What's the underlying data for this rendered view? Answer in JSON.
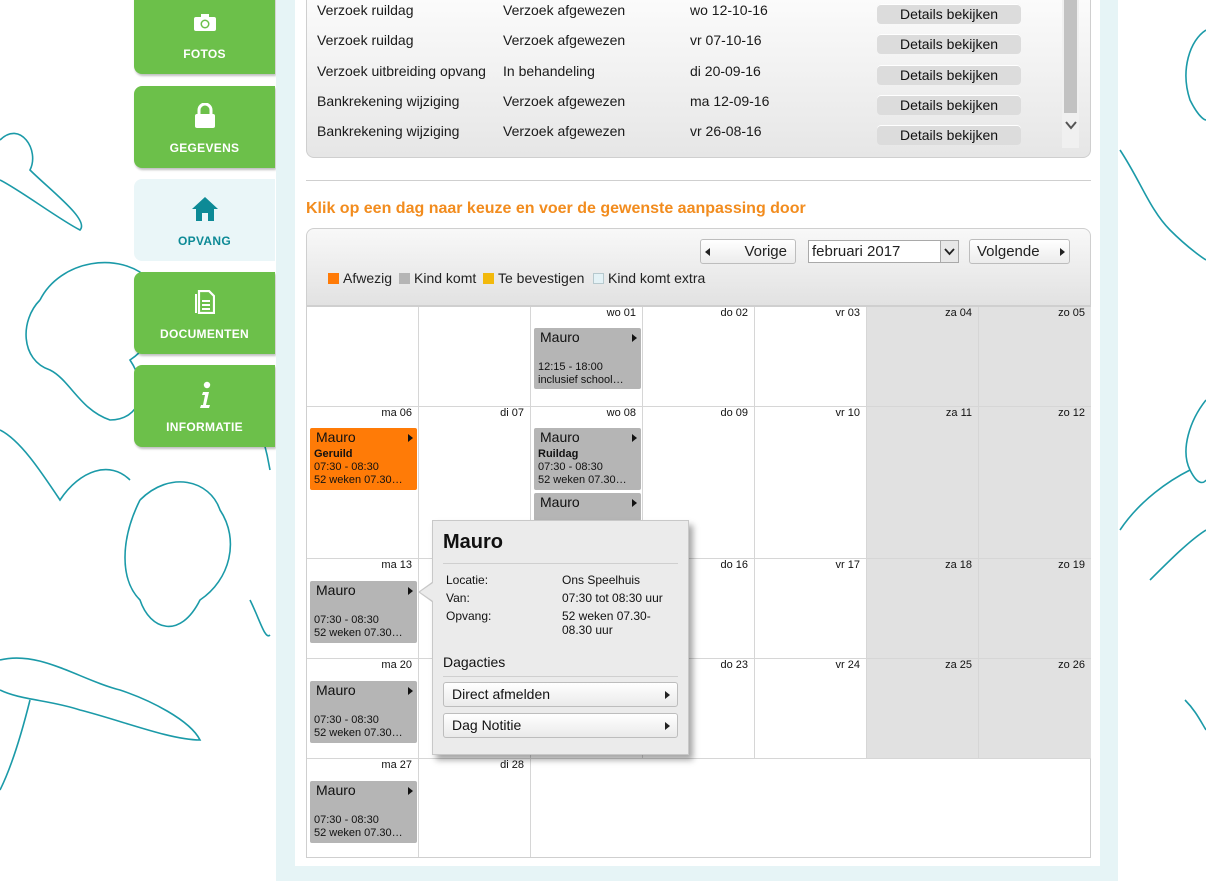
{
  "sidebar": {
    "items": [
      {
        "label": "FOTOS",
        "icon": "camera-icon"
      },
      {
        "label": "GEGEVENS",
        "icon": "lock-icon"
      },
      {
        "label": "OPVANG",
        "icon": "home-icon",
        "active": true
      },
      {
        "label": "DOCUMENTEN",
        "icon": "document-icon"
      },
      {
        "label": "INFORMATIE",
        "icon": "info-icon"
      }
    ]
  },
  "requests": {
    "rows": [
      {
        "type": "Verzoek ruildag",
        "status": "Verzoek afgewezen",
        "date": "wo 12-10-16",
        "button": "Details bekijken"
      },
      {
        "type": "Verzoek ruildag",
        "status": "Verzoek afgewezen",
        "date": "vr 07-10-16",
        "button": "Details bekijken"
      },
      {
        "type": "Verzoek uitbreiding opvang",
        "status": "In behandeling",
        "date": "di 20-09-16",
        "button": "Details bekijken"
      },
      {
        "type": "Bankrekening wijziging",
        "status": "Verzoek afgewezen",
        "date": "ma 12-09-16",
        "button": "Details bekijken"
      },
      {
        "type": "Bankrekening wijziging",
        "status": "Verzoek afgewezen",
        "date": "vr 26-08-16",
        "button": "Details bekijken"
      }
    ]
  },
  "calendar": {
    "instruction": "Klik op een dag naar keuze en voer de gewenste aanpassing door",
    "prev_label": "Vorige",
    "next_label": "Volgende",
    "month": "februari 2017",
    "legend": [
      {
        "label": "Afwezig",
        "color": "#ff7b07"
      },
      {
        "label": "Kind komt",
        "color": "#b5b5b5"
      },
      {
        "label": "Te bevestigen",
        "color": "#f2b90c"
      },
      {
        "label": "Kind komt extra",
        "color": "#e4f2f6"
      }
    ],
    "day_labels": {
      "wo01": "wo 01",
      "do02": "do 02",
      "vr03": "vr 03",
      "za04": "za 04",
      "zo05": "zo 05",
      "ma06": "ma 06",
      "di07": "di 07",
      "wo08": "wo 08",
      "do09": "do 09",
      "vr10": "vr 10",
      "za11": "za 11",
      "zo12": "zo 12",
      "ma13": "ma 13",
      "do16": "do 16",
      "vr17": "vr 17",
      "za18": "za 18",
      "zo19": "zo 19",
      "ma20": "ma 20",
      "do23": "do 23",
      "vr24": "vr 24",
      "za25": "za 25",
      "zo26": "zo 26",
      "ma27": "ma 27",
      "di28": "di 28"
    },
    "events": {
      "wo01": {
        "name": "Mauro",
        "line1": "12:15 - 18:00",
        "line2": "inclusief school…"
      },
      "ma06": {
        "name": "Mauro",
        "tag": "Geruild",
        "line1": "07:30 - 08:30",
        "line2": "52 weken 07.30…"
      },
      "wo08a": {
        "name": "Mauro",
        "tag": "Ruildag",
        "line1": "07:30 - 08:30",
        "line2": "52 weken 07.30…"
      },
      "wo08b": {
        "name": "Mauro"
      },
      "ma13": {
        "name": "Mauro",
        "line1": "07:30 - 08:30",
        "line2": "52 weken 07.30…"
      },
      "ma20": {
        "name": "Mauro",
        "line1": "07:30 - 08:30",
        "line2": "52 weken 07.30…"
      },
      "ma27": {
        "name": "Mauro",
        "line1": "07:30 - 08:30",
        "line2": "52 weken 07.30…"
      }
    }
  },
  "popup": {
    "title": "Mauro",
    "location_label": "Locatie:",
    "location_value": "Ons Speelhuis",
    "from_label": "Van:",
    "from_value": "07:30 tot 08:30 uur",
    "care_label": "Opvang:",
    "care_value": "52 weken 07.30-08.30 uur",
    "section_title": "Dagacties",
    "action_unsubscribe": "Direct afmelden",
    "action_note": "Dag Notitie"
  }
}
